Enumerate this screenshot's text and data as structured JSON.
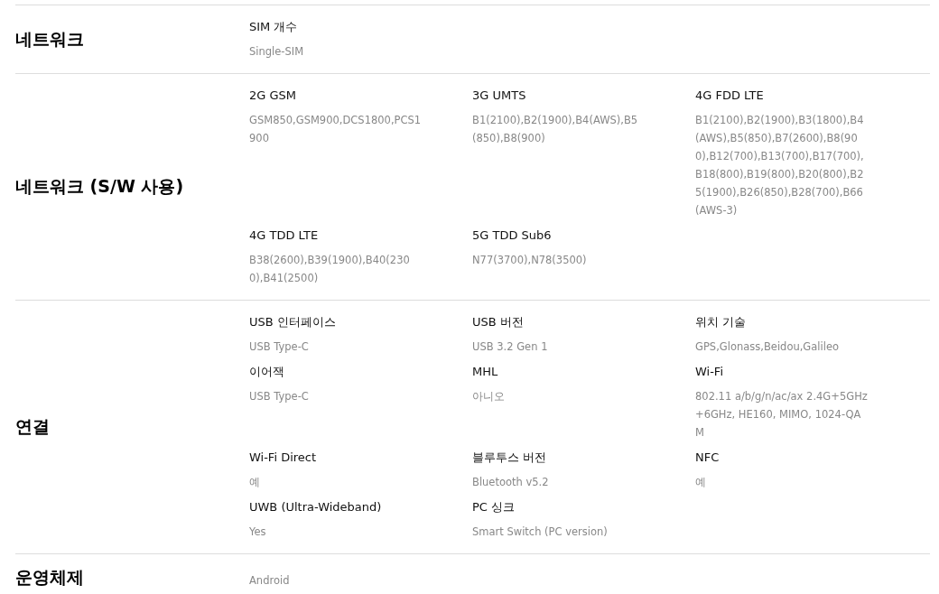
{
  "sections": [
    {
      "title": "네트워크",
      "items": [
        {
          "label": "SIM 개수",
          "value": "Single-SIM"
        }
      ]
    },
    {
      "title": "네트워크 (S/W 사용)",
      "items": [
        {
          "label": "2G GSM",
          "value": "GSM850,GSM900,DCS1800,PCS1900"
        },
        {
          "label": "3G UMTS",
          "value": "B1(2100),B2(1900),B4(AWS),B5(850),B8(900)"
        },
        {
          "label": "4G FDD LTE",
          "value": "B1(2100),B2(1900),B3(1800),B4(AWS),B5(850),B7(2600),B8(900),B12(700),B13(700),B17(700),B18(800),B19(800),B20(800),B25(1900),B26(850),B28(700),B66(AWS-3)"
        },
        {
          "label": "4G TDD LTE",
          "value": "B38(2600),B39(1900),B40(2300),B41(2500)"
        },
        {
          "label": "5G TDD Sub6",
          "value": "N77(3700),N78(3500)"
        }
      ]
    },
    {
      "title": "연결",
      "items": [
        {
          "label": "USB 인터페이스",
          "value": "USB Type-C"
        },
        {
          "label": "USB 버전",
          "value": "USB 3.2 Gen 1"
        },
        {
          "label": "위치 기술",
          "value": "GPS,Glonass,Beidou,Galileo"
        },
        {
          "label": "이어잭",
          "value": "USB Type-C"
        },
        {
          "label": "MHL",
          "value": "아니오"
        },
        {
          "label": "Wi-Fi",
          "value": "802.11 a/b/g/n/ac/ax 2.4G+5GHz+6GHz, HE160, MIMO, 1024-QAM"
        },
        {
          "label": "Wi-Fi Direct",
          "value": "예"
        },
        {
          "label": "블루투스 버전",
          "value": "Bluetooth v5.2"
        },
        {
          "label": "NFC",
          "value": "예"
        },
        {
          "label": "UWB (Ultra-Wideband)",
          "value": "Yes"
        },
        {
          "label": "PC 싱크",
          "value": "Smart Switch (PC version)"
        }
      ]
    },
    {
      "title": "운영체제",
      "items": [
        {
          "value": "Android"
        }
      ]
    }
  ]
}
